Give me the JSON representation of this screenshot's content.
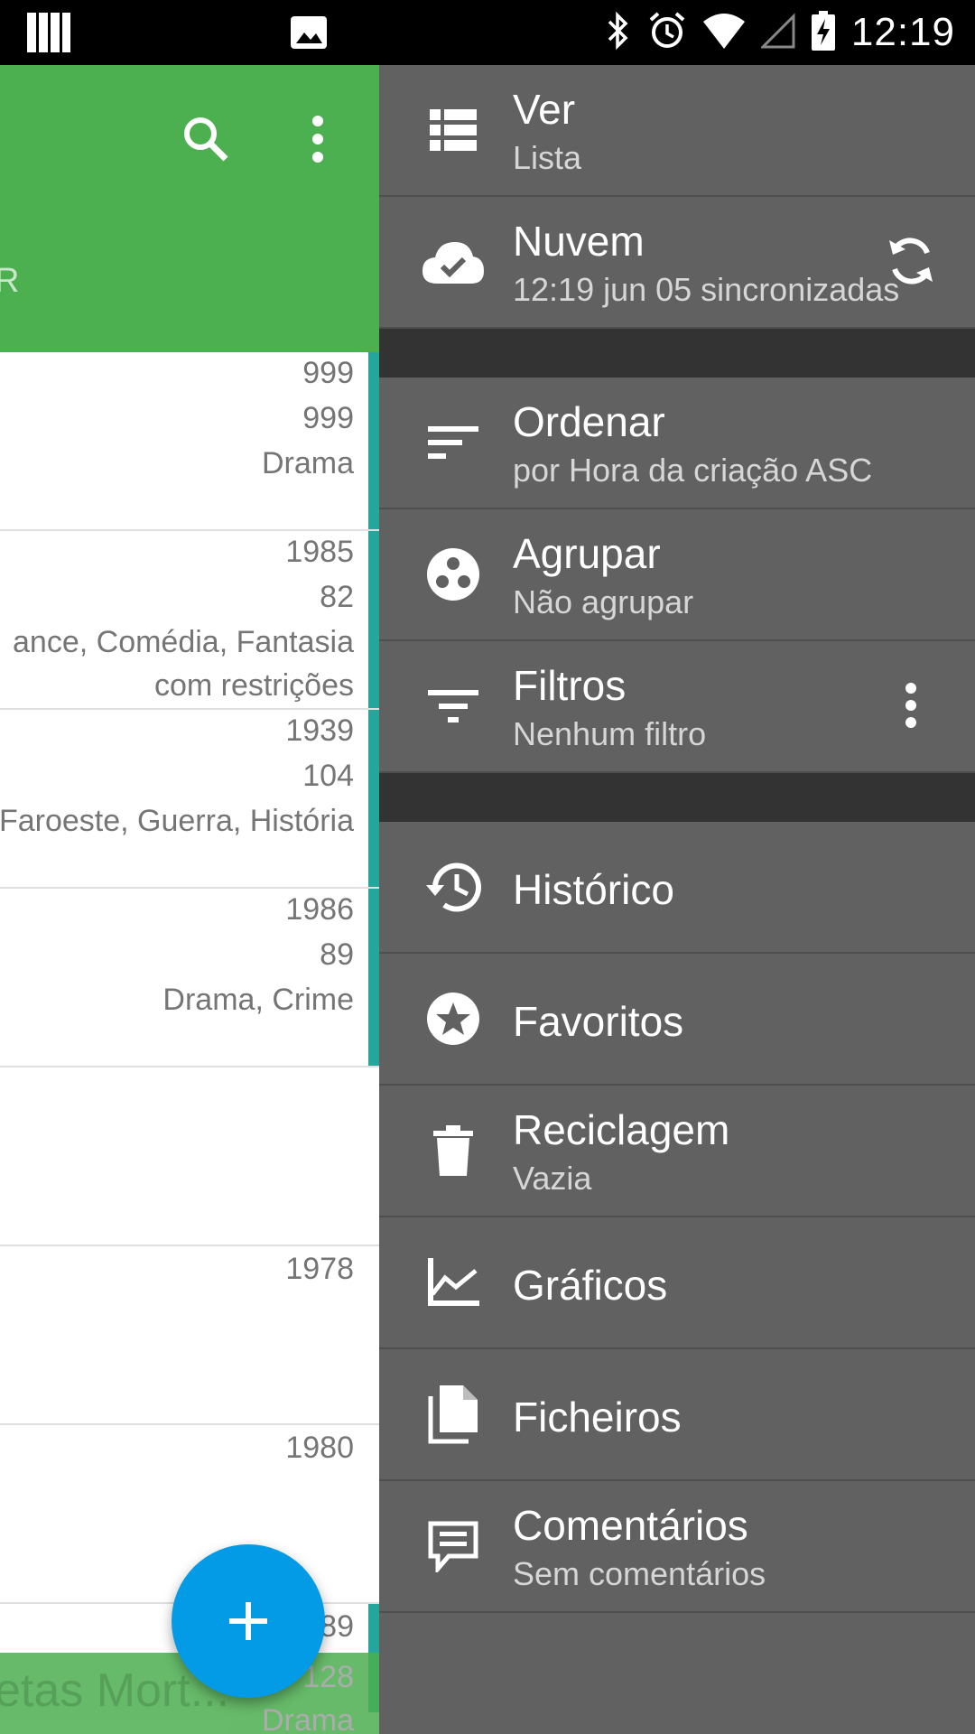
{
  "status_bar": {
    "time": "12:19",
    "icons": [
      "sim-icon",
      "image-icon",
      "bluetooth-icon",
      "alarm-icon",
      "wifi-icon",
      "signal-icon",
      "battery-charging-icon"
    ]
  },
  "app_bar": {
    "tab_partial": "R",
    "icons": [
      "search-icon",
      "more-vert-icon"
    ]
  },
  "list": {
    "rows": [
      {
        "lines": [
          "999",
          "999",
          "Drama"
        ]
      },
      {
        "lines": [
          "1985",
          "82",
          "ance, Comédia, Fantasia",
          "com restrições"
        ]
      },
      {
        "lines": [
          "1939",
          "104",
          "Faroeste, Guerra, História"
        ]
      },
      {
        "lines": [
          "1986",
          "89",
          "Drama, Crime"
        ]
      },
      {
        "lines": []
      },
      {
        "lines": [
          "1978"
        ]
      },
      {
        "lines": [
          "1980"
        ]
      }
    ],
    "bottom_item": {
      "title": "etas Mort...",
      "lines": [
        "89",
        "128",
        "Drama"
      ]
    }
  },
  "fab": {
    "label": "+"
  },
  "drawer": {
    "items": [
      {
        "title": "Ver",
        "subtitle": "Lista",
        "icon": "view-list-icon"
      },
      {
        "title": "Nuvem",
        "subtitle": "12:19 jun 05 sincronizadas",
        "icon": "cloud-done-icon",
        "trailing": "sync-icon"
      },
      {
        "title": "Ordenar",
        "subtitle": "por Hora da criação ASC",
        "icon": "sort-icon"
      },
      {
        "title": "Agrupar",
        "subtitle": "Não agrupar",
        "icon": "group-work-icon"
      },
      {
        "title": "Filtros",
        "subtitle": "Nenhum filtro",
        "icon": "filter-icon",
        "trailing": "more-vert-icon"
      },
      {
        "title": "Histórico",
        "icon": "history-icon"
      },
      {
        "title": "Favoritos",
        "icon": "star-circle-icon"
      },
      {
        "title": "Reciclagem",
        "subtitle": "Vazia",
        "icon": "delete-icon"
      },
      {
        "title": "Gráficos",
        "icon": "chart-icon"
      },
      {
        "title": "Ficheiros",
        "icon": "files-icon"
      },
      {
        "title": "Comentários",
        "subtitle": "Sem comentários",
        "icon": "comment-icon"
      }
    ]
  },
  "colors": {
    "app_bar": "#4CAF50",
    "drawer": "#616161",
    "drawer_separator": "#333333",
    "fab": "#039BE5",
    "row_stripe": "#26A69A"
  }
}
